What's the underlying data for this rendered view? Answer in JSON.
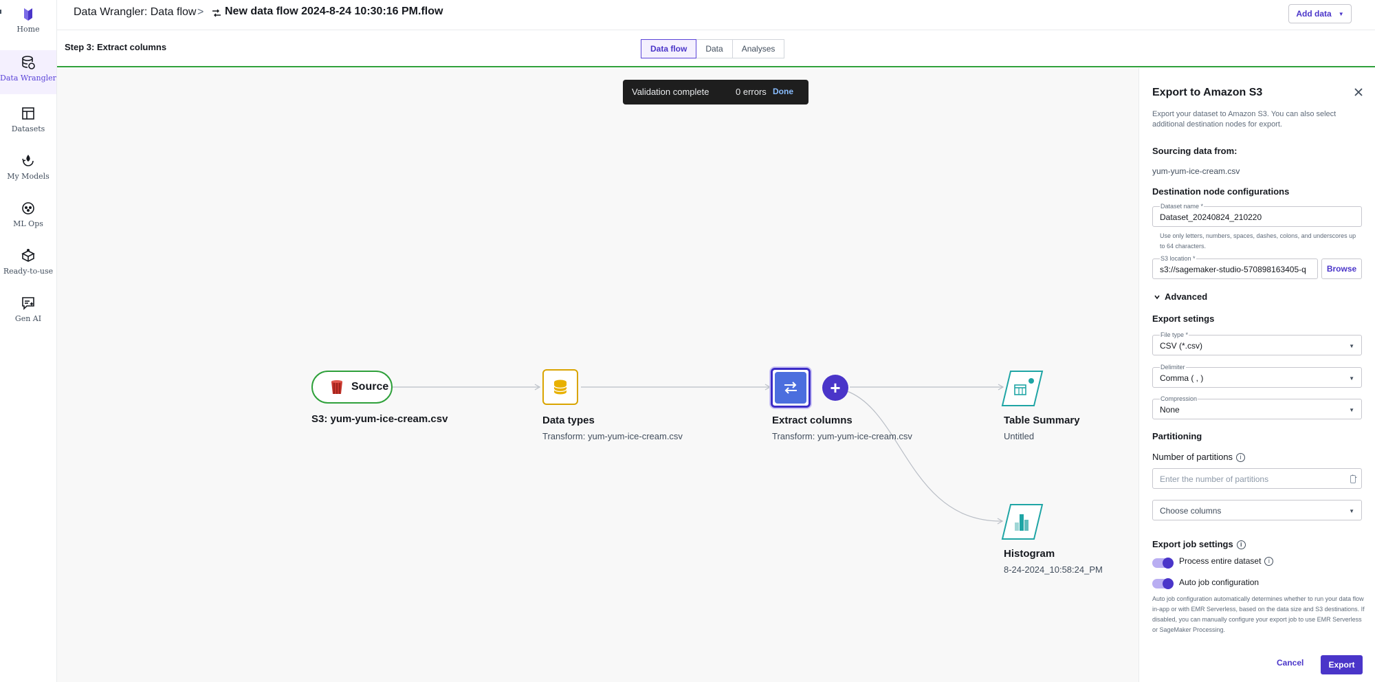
{
  "nav": {
    "items": [
      {
        "label": "Home",
        "icon": "home-icon"
      },
      {
        "label": "Data Wrangler",
        "icon": "data-wrangler-icon",
        "active": true
      },
      {
        "label": "Datasets",
        "icon": "datasets-icon"
      },
      {
        "label": "My Models",
        "icon": "models-icon"
      },
      {
        "label": "ML Ops",
        "icon": "ml-ops-icon"
      },
      {
        "label": "Ready-to-use",
        "icon": "ready-to-use-icon"
      },
      {
        "label": "Gen AI",
        "icon": "gen-ai-icon"
      }
    ]
  },
  "header": {
    "breadcrumb_root": "Data Wrangler: Data flow",
    "breadcrumb_sep": ">",
    "breadcrumb_current": "New data flow 2024-8-24 10:30:16 PM.flow",
    "add_data_label": "Add data"
  },
  "subheader": {
    "step_title": "Step 3: Extract columns",
    "tabs": [
      {
        "label": "Data flow",
        "active": true
      },
      {
        "label": "Data"
      },
      {
        "label": "Analyses"
      }
    ]
  },
  "flash": {
    "message": "Validation complete",
    "errors": "0 errors",
    "done_label": "Done"
  },
  "flow": {
    "source": {
      "pill_label": "Source",
      "title": "S3: yum-yum-ice-cream.csv"
    },
    "data_types": {
      "title": "Data types",
      "subtitle": "Transform: yum-yum-ice-cream.csv"
    },
    "extract_columns": {
      "title": "Extract columns",
      "subtitle": "Transform: yum-yum-ice-cream.csv"
    },
    "add_step": {
      "label": "+"
    },
    "table_summary": {
      "title": "Table Summary",
      "subtitle": "Untitled"
    },
    "histogram": {
      "title": "Histogram",
      "subtitle": "8-24-2024_10:58:24_PM"
    }
  },
  "panel": {
    "title": "Export to Amazon S3",
    "description": "Export your dataset to Amazon S3. You can also select additional destination nodes for export.",
    "sourcing_heading": "Sourcing data from:",
    "sourcing_value": "yum-yum-ice-cream.csv",
    "dest_heading": "Destination node configurations",
    "dataset_name": {
      "label": "Dataset name *",
      "value": "Dataset_20240824_210220"
    },
    "dataset_hint": "Use only letters, numbers, spaces, dashes, colons, and underscores up to 64 characters.",
    "s3_location": {
      "label": "S3 location *",
      "value": "s3://sagemaker-studio-570898163405-q"
    },
    "browse_label": "Browse",
    "advanced_label": "Advanced",
    "export_settings_heading": "Export setings",
    "file_type": {
      "label": "File type *",
      "value": "CSV (*.csv)"
    },
    "delimiter": {
      "label": "Delimiter",
      "value": "Comma ( , )"
    },
    "compression": {
      "label": "Compression",
      "value": "None"
    },
    "partitioning_heading": "Partitioning",
    "num_partitions_label": "Number of partitions",
    "num_partitions_placeholder": "Enter the number of partitions",
    "choose_columns_placeholder": "Choose columns",
    "job_settings_heading": "Export job settings",
    "process_entire_label": "Process entire dataset",
    "auto_job_label": "Auto job configuration",
    "auto_job_desc": "Auto job configuration automatically determines whether to run your data flow in-app or with EMR Serverless, based on the data size and S3 destinations. If disabled, you can manually configure your export job to use EMR Serverless or SageMaker Processing.",
    "cancel_label": "Cancel",
    "export_label": "Export"
  },
  "colors": {
    "accent": "#4a35c9",
    "source_border": "#2ea03a",
    "data_types_border": "#d9a400",
    "teal_icon": "#1fa5a5"
  }
}
